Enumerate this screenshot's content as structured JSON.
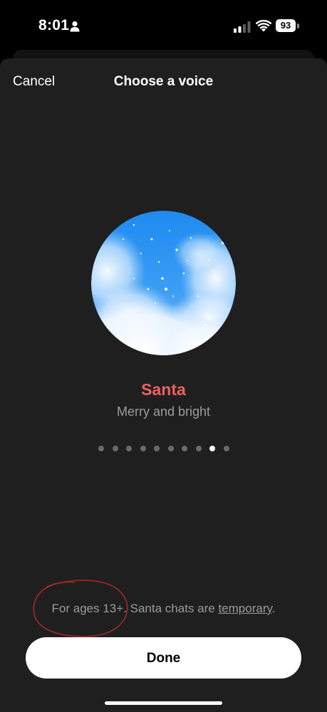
{
  "status_bar": {
    "time": "8:01",
    "battery_level": "93",
    "cellular_bars_active": 2,
    "cellular_bars_total": 4
  },
  "nav": {
    "cancel_label": "Cancel",
    "title": "Choose a voice"
  },
  "voice": {
    "name": "Santa",
    "description": "Merry and bright",
    "accent_color": "#f06060"
  },
  "pager": {
    "count": 10,
    "active_index": 8
  },
  "footnote": {
    "prefix": "For ages 13+. Santa chats are ",
    "link_label": "temporary",
    "suffix": "."
  },
  "done_label": "Done",
  "colors": {
    "sheet_background": "#1f1f20",
    "annotation_ink": "#a8281e"
  }
}
